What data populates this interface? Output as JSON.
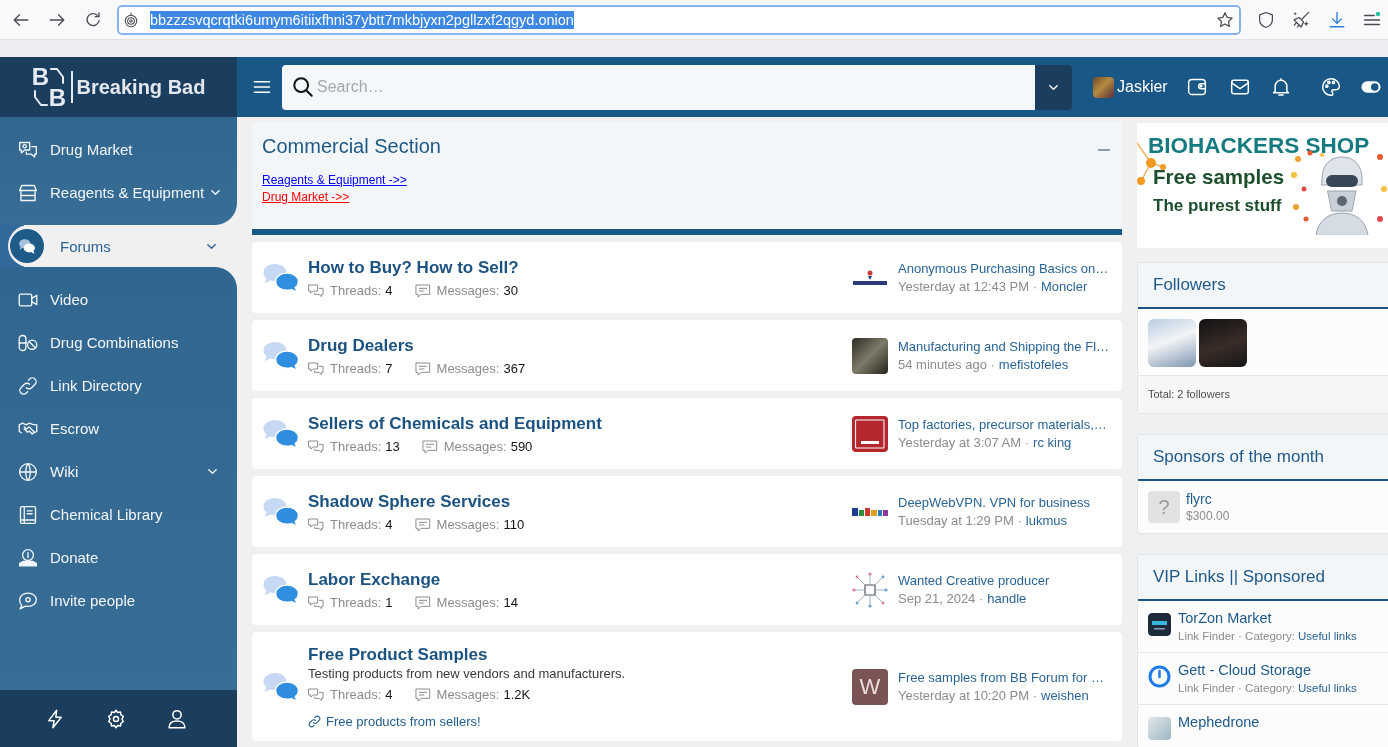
{
  "browser": {
    "url": "bbzzzsvqcrqtki6umym6itiixfhni37ybtt7mkbjyxn2pgllzxf2qgyd.onion",
    "url_selected": true
  },
  "logo": {
    "mark": [
      "B",
      "B"
    ],
    "name": "Breaking Bad"
  },
  "header": {
    "search_placeholder": "Search…",
    "username": "Jaskier"
  },
  "sidebar": {
    "items": [
      {
        "label": "Drug Market",
        "selected": false,
        "expandable": false
      },
      {
        "label": "Reagents & Equipment",
        "selected": false,
        "expandable": true
      },
      {
        "label": "Forums",
        "selected": true,
        "expandable": true
      },
      {
        "label": "Video",
        "selected": false,
        "expandable": false
      },
      {
        "label": "Drug Combinations",
        "selected": false,
        "expandable": false
      },
      {
        "label": "Link Directory",
        "selected": false,
        "expandable": false
      },
      {
        "label": "Escrow",
        "selected": false,
        "expandable": false
      },
      {
        "label": "Wiki",
        "selected": false,
        "expandable": true
      },
      {
        "label": "Chemical Library",
        "selected": false,
        "expandable": false
      },
      {
        "label": "Donate",
        "selected": false,
        "expandable": false
      },
      {
        "label": "Invite people",
        "selected": false,
        "expandable": false
      }
    ]
  },
  "commercial_section": {
    "title": "Commercial Section",
    "collapsed": false,
    "links": [
      {
        "label": "Reagents & Equipment ->>",
        "color": "#0000ff"
      },
      {
        "label": "Drug Market ->>",
        "color": "#ff0000"
      }
    ]
  },
  "forums": [
    {
      "title": "How to Buy? How to Sell?",
      "threads_label": "Threads:",
      "threads": "4",
      "messages_label": "Messages:",
      "messages": "30",
      "last_post": {
        "title": "Anonymous Purchasing Basics on…",
        "time": "Yesterday at 12:43 PM ·",
        "user": "Moncler",
        "avatar": {
          "kind": "image"
        }
      }
    },
    {
      "title": "Drug Dealers",
      "threads_label": "Threads:",
      "threads": "7",
      "messages_label": "Messages:",
      "messages": "367",
      "last_post": {
        "title": "Manufacturing and Shipping the Fl…",
        "time": "54 minutes ago ·",
        "user": "mefistofeles",
        "avatar": {
          "kind": "image"
        }
      }
    },
    {
      "title": "Sellers of Chemicals and Equipment",
      "threads_label": "Threads:",
      "threads": "13",
      "messages_label": "Messages:",
      "messages": "590",
      "last_post": {
        "title": "Top factories, precursor materials,…",
        "time": "Yesterday at 3:07 AM ·",
        "user": "rc king",
        "avatar": {
          "kind": "image"
        }
      }
    },
    {
      "title": "Shadow Sphere Services",
      "threads_label": "Threads:",
      "threads": "4",
      "messages_label": "Messages:",
      "messages": "110",
      "last_post": {
        "title": "DeepWebVPN. VPN for business",
        "time": "Tuesday at 1:29 PM ·",
        "user": "lukmus",
        "avatar": {
          "kind": "image"
        }
      }
    },
    {
      "title": "Labor Exchange",
      "threads_label": "Threads:",
      "threads": "1",
      "messages_label": "Messages:",
      "messages": "14",
      "last_post": {
        "title": "Wanted Creative producer",
        "time": "Sep 21, 2024 ·",
        "user": "handle",
        "avatar": {
          "kind": "image"
        }
      }
    },
    {
      "title": "Free Product Samples",
      "description": "Testing products from new vendors and manufacturers.",
      "threads_label": "Threads:",
      "threads": "4",
      "messages_label": "Messages:",
      "messages": "1.2K",
      "links": [
        {
          "label": "Free products from sellers!"
        }
      ],
      "last_post": {
        "title": "Free samples from BB Forum for …",
        "time": "Yesterday at 10:20 PM ·",
        "user": "weishen",
        "avatar": {
          "kind": "letter",
          "letter": "W"
        }
      }
    }
  ],
  "aside": {
    "banner": {
      "title": "BIOHACKERS SHOP",
      "lines": [
        "Free samples",
        "The purest stuff"
      ]
    },
    "followers": {
      "title": "Followers",
      "avatars": [
        {
          "kind": "photo"
        },
        {
          "kind": "photo"
        }
      ],
      "total": "Total: 2 followers"
    },
    "sponsors": {
      "title": "Sponsors of the month",
      "items": [
        {
          "name": "flyrc",
          "amount": "$300.00",
          "avatar_text": "?"
        }
      ]
    },
    "vip_links": {
      "title": "VIP Links || Sponsored",
      "items": [
        {
          "name": "TorZon Market",
          "meta": "Link Finder · Category:",
          "category": "Useful links"
        },
        {
          "name": "Gett - Cloud Storage",
          "meta": "Link Finder · Category:",
          "category": "Useful links"
        },
        {
          "name": "Mephedrone"
        }
      ]
    }
  }
}
